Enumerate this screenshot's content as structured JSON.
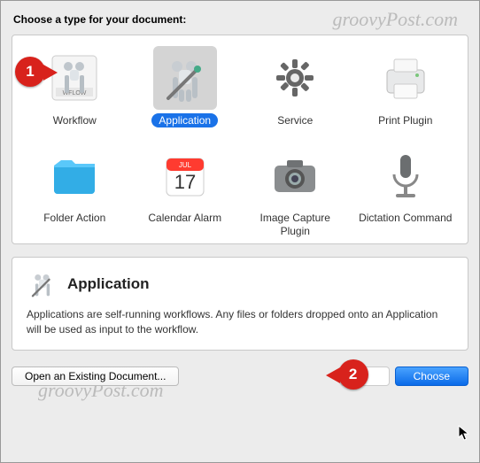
{
  "heading": "Choose a type for your document:",
  "types": [
    {
      "label": "Workflow"
    },
    {
      "label": "Application"
    },
    {
      "label": "Service"
    },
    {
      "label": "Print Plugin"
    },
    {
      "label": "Folder Action"
    },
    {
      "label": "Calendar Alarm"
    },
    {
      "label": "Image Capture Plugin"
    },
    {
      "label": "Dictation Command"
    }
  ],
  "selected_index": 1,
  "description": {
    "title": "Application",
    "text": "Applications are self-running workflows. Any files or folders dropped onto an Application will be used as input to the workflow."
  },
  "buttons": {
    "open_existing": "Open an Existing Document...",
    "choose": "Choose"
  },
  "callouts": {
    "one": "1",
    "two": "2"
  },
  "watermark": "groovyPost.com"
}
